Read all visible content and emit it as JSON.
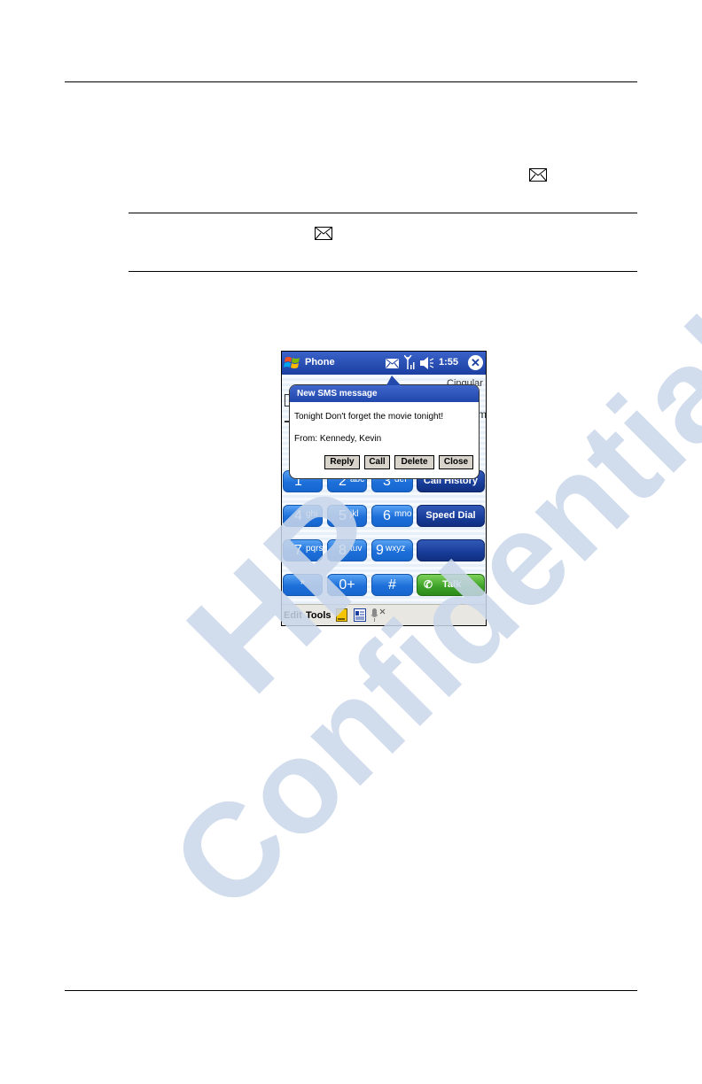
{
  "page": {
    "watermark_line1": "HP",
    "watermark_line2": "Confidential"
  },
  "screen": {
    "title": "Phone",
    "time": "1:55",
    "carrier": "Cingular",
    "close_glyph": "✕",
    "icons": [
      "windows-start-icon",
      "envelope-icon",
      "signal-antenna-icon",
      "speaker-icon",
      "close-icon"
    ]
  },
  "notification": {
    "title": "New SMS message",
    "message": "Tonight Don't forget the movie tonight!",
    "from": "From: Kennedy, Kevin",
    "buttons": {
      "reply": "Reply",
      "call": "Call",
      "delete": "Delete",
      "close": "Close"
    }
  },
  "keypad": {
    "k1": {
      "digit": "1",
      "letters": ""
    },
    "k2": {
      "digit": "2",
      "letters": "abc"
    },
    "k3": {
      "digit": "3",
      "letters": "def"
    },
    "k4": {
      "digit": "4",
      "letters": "ghi"
    },
    "k5": {
      "digit": "5",
      "letters": "jkl"
    },
    "k6": {
      "digit": "6",
      "letters": "mno"
    },
    "k7": {
      "digit": "7",
      "letters": "pqrs"
    },
    "k8": {
      "digit": "8",
      "letters": "tuv"
    },
    "k9": {
      "digit": "9",
      "letters": "wxyz"
    },
    "kstar": "*",
    "k0": "0+",
    "khash": "#",
    "call_history": "Call History",
    "speed_dial": "Speed Dial",
    "talk": "Talk"
  },
  "menubar": {
    "edit": "Edit",
    "tools": "Tools",
    "icons": [
      "notes-icon",
      "contacts-icon",
      "microphone-icon"
    ]
  },
  "colors": {
    "titlebar": "#1b3fa1",
    "key_blue": "#1d6fd9",
    "function_key": "#173c98",
    "talk_green": "#3ca026",
    "watermark": "#c9d6ea"
  }
}
